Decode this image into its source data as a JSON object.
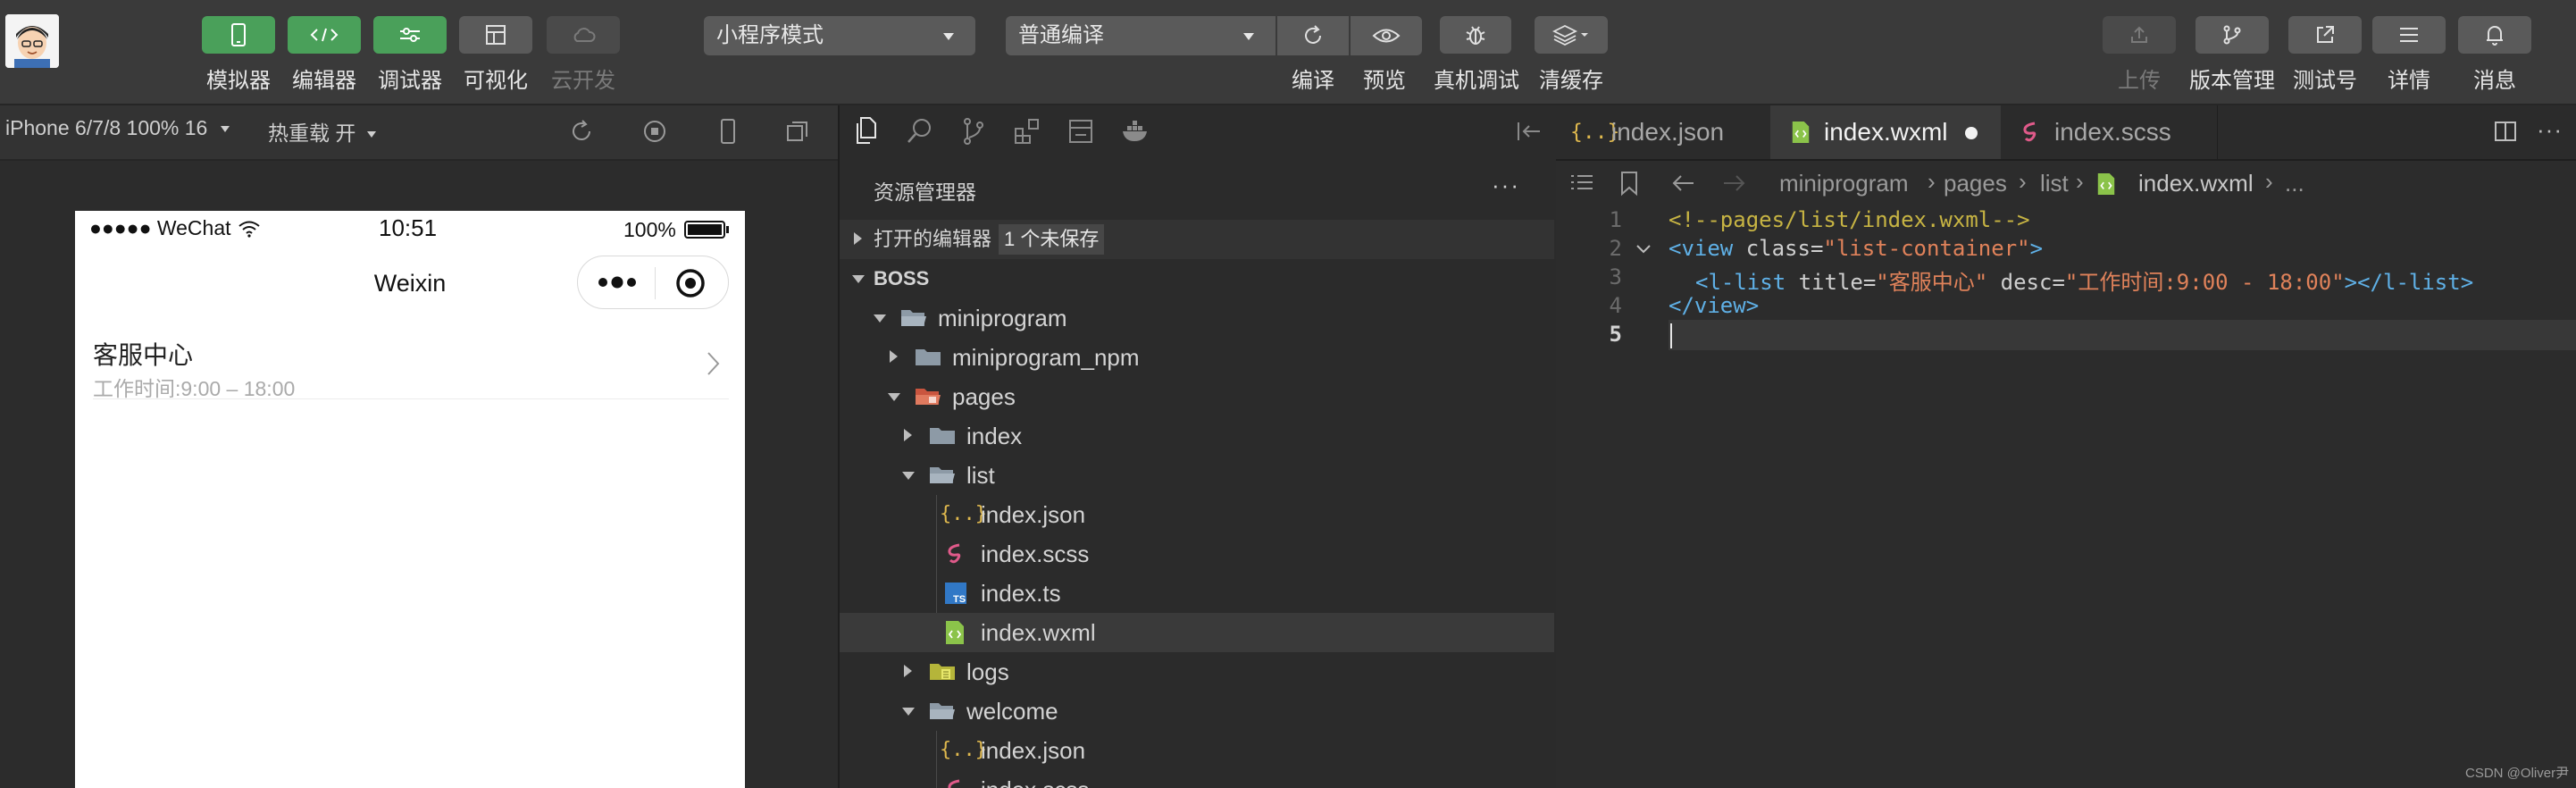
{
  "toolbar": {
    "buttons": [
      {
        "label": "模拟器"
      },
      {
        "label": "编辑器"
      },
      {
        "label": "调试器"
      },
      {
        "label": "可视化"
      },
      {
        "label": "云开发"
      }
    ],
    "mode_select": "小程序模式",
    "compile_select": "普通编译",
    "actions": [
      {
        "label": "编译"
      },
      {
        "label": "预览"
      },
      {
        "label": "真机调试"
      },
      {
        "label": "清缓存"
      }
    ],
    "right": [
      {
        "label": "上传"
      },
      {
        "label": "版本管理"
      },
      {
        "label": "测试号"
      },
      {
        "label": "详情"
      },
      {
        "label": "消息"
      }
    ]
  },
  "simulator": {
    "device": "iPhone 6/7/8 100% 16",
    "hot_reload": "热重载 开",
    "status_left": "●●●●● WeChat",
    "status_time": "10:51",
    "status_battery": "100%",
    "nav_title": "Weixin",
    "list_item_title": "客服中心",
    "list_item_desc": "工作时间:9:00 – 18:00"
  },
  "explorer": {
    "title": "资源管理器",
    "more": "···",
    "open_editors": "打开的编辑器",
    "unsaved": "1 个未保存",
    "project": "BOSS",
    "tree": [
      {
        "name": "miniprogram"
      },
      {
        "name": "miniprogram_npm"
      },
      {
        "name": "pages"
      },
      {
        "name": "index"
      },
      {
        "name": "list"
      },
      {
        "name": "index.json"
      },
      {
        "name": "index.scss"
      },
      {
        "name": "index.ts"
      },
      {
        "name": "index.wxml"
      },
      {
        "name": "logs"
      },
      {
        "name": "welcome"
      },
      {
        "name": "index.json"
      },
      {
        "name": "index.scss"
      }
    ]
  },
  "editor": {
    "tabs": [
      {
        "name": "index.json"
      },
      {
        "name": "index.wxml"
      },
      {
        "name": "index.scss"
      }
    ],
    "breadcrumb": [
      "miniprogram",
      "pages",
      "list",
      "index.wxml",
      "..."
    ],
    "line_numbers": [
      "1",
      "2",
      "3",
      "4",
      "5"
    ],
    "code": {
      "l1": "<!--pages/list/index.wxml-->",
      "l2_open": "<view ",
      "l2_attr": "class=",
      "l2_val": "\"list-container\"",
      "l2_close": ">",
      "l3_open": "<l-list ",
      "l3_attr1": "title=",
      "l3_val1": "\"客服中心\"",
      "l3_attr2": " desc=",
      "l3_val2": "\"工作时间:9:00 - 18:00\"",
      "l3_close": "></l-list>",
      "l4": "</view>"
    },
    "watermark": "CSDN @Oliver尹"
  },
  "colors": {
    "green_button": "#4aa05a",
    "toolbar_bg": "#3a3a3a",
    "editor_bg": "#2c2c2c",
    "json_icon": "#e0b94e",
    "wxml_icon": "#8bc34a",
    "scss_icon": "#e05a8a",
    "ts_icon": "#3178c6"
  }
}
